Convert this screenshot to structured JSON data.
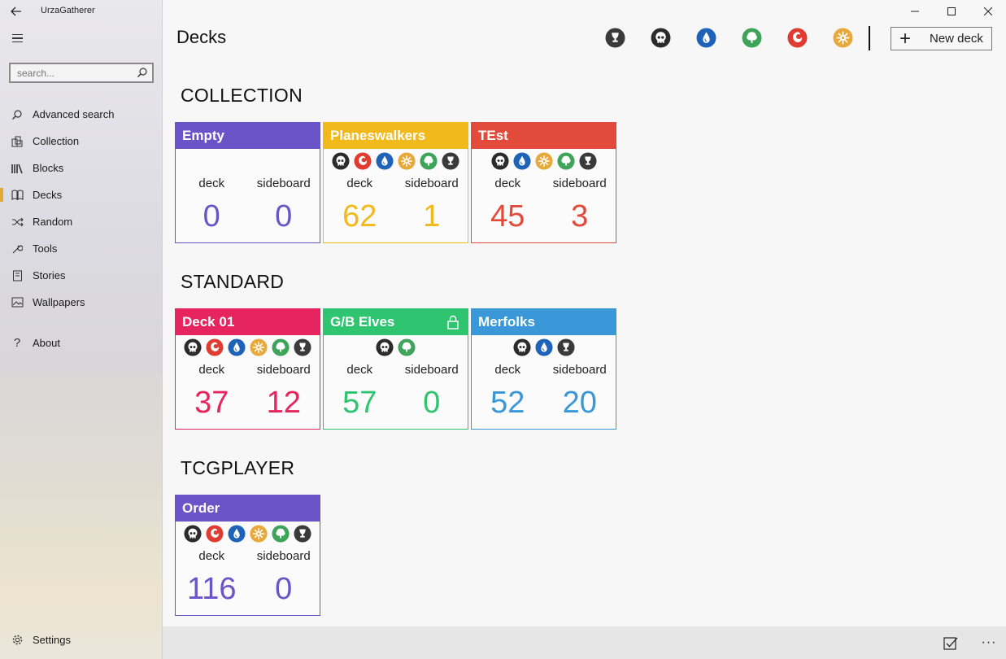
{
  "app": {
    "title": "UrzaGatherer",
    "back_glyph": "←"
  },
  "search": {
    "placeholder": "search..."
  },
  "nav": {
    "items": [
      {
        "label": "Advanced search",
        "icon": "search-icon"
      },
      {
        "label": "Collection",
        "icon": "collection-icon"
      },
      {
        "label": "Blocks",
        "icon": "blocks-icon"
      },
      {
        "label": "Decks",
        "icon": "decks-icon",
        "active": true
      },
      {
        "label": "Random",
        "icon": "shuffle-icon"
      },
      {
        "label": "Tools",
        "icon": "wrench-icon"
      },
      {
        "label": "Stories",
        "icon": "book-icon"
      },
      {
        "label": "Wallpapers",
        "icon": "image-icon"
      }
    ],
    "about": {
      "label": "About",
      "icon": "help-icon"
    },
    "settings": {
      "label": "Settings",
      "icon": "gear-icon"
    }
  },
  "header": {
    "title": "Decks",
    "new_deck_label": "New deck",
    "color_filters": [
      "colorless",
      "black",
      "blue",
      "green",
      "red",
      "white"
    ]
  },
  "mana_colors": {
    "black": "#2b2b2b",
    "red": "#e03c31",
    "blue": "#1f63b8",
    "white": "#e8a83a",
    "green": "#3ea45a",
    "colorless": "#3a3a3a"
  },
  "labels": {
    "deck": "deck",
    "sideboard": "sideboard"
  },
  "sections": [
    {
      "title": "COLLECTION",
      "decks": [
        {
          "name": "Empty",
          "color": "#6a55c8",
          "colors": [],
          "deck": "0",
          "sideboard": "0",
          "locked": false
        },
        {
          "name": "Planeswalkers",
          "color": "#f2b91c",
          "colors": [
            "black",
            "red",
            "blue",
            "white",
            "green",
            "colorless"
          ],
          "deck": "62",
          "sideboard": "1",
          "locked": false
        },
        {
          "name": "TEst",
          "color": "#e24b3b",
          "colors": [
            "black",
            "blue",
            "white",
            "green",
            "colorless"
          ],
          "deck": "45",
          "sideboard": "3",
          "locked": false
        }
      ]
    },
    {
      "title": "STANDARD",
      "decks": [
        {
          "name": "Deck 01",
          "color": "#e6255e",
          "colors": [
            "black",
            "red",
            "blue",
            "white",
            "green",
            "colorless"
          ],
          "deck": "37",
          "sideboard": "12",
          "locked": false
        },
        {
          "name": "G/B Elves",
          "color": "#2fc470",
          "colors": [
            "black",
            "green"
          ],
          "deck": "57",
          "sideboard": "0",
          "locked": true
        },
        {
          "name": "Merfolks",
          "color": "#3a97d8",
          "colors": [
            "black",
            "blue",
            "colorless"
          ],
          "deck": "52",
          "sideboard": "20",
          "locked": false
        }
      ]
    },
    {
      "title": "TCGPLAYER",
      "decks": [
        {
          "name": "Order",
          "color": "#6a55c8",
          "colors": [
            "black",
            "red",
            "blue",
            "white",
            "green",
            "colorless"
          ],
          "deck": "116",
          "sideboard": "0",
          "locked": false
        }
      ]
    }
  ],
  "appbar": {
    "select_icon": "checkbox-icon",
    "more_label": "···"
  }
}
